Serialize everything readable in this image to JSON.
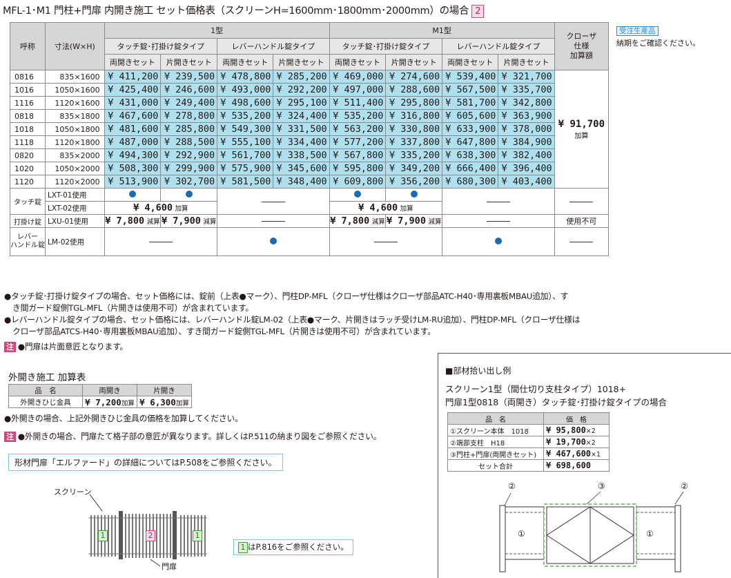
{
  "title": {
    "text": "MFL-1･M1 門柱+門扉 内開き施工 セット価格表（スクリーンH=1600mm･1800mm･2000mm）の場合",
    "badge": "2"
  },
  "juchu": {
    "label": "受注生産品",
    "note": "納期をご確認ください。"
  },
  "table": {
    "h_name": "呼称",
    "h_size": "寸法(W×H)",
    "h_type1": "1型",
    "h_typeM1": "M1型",
    "h_touch": "タッチ錠･打掛け錠タイプ",
    "h_lever": "レバーハンドル錠タイプ",
    "h_both": "両開きセット",
    "h_single": "片開きセット",
    "h_closer": "クローザ",
    "h_closer2": "仕様",
    "h_closer3": "加算額",
    "closer_price": "¥ 91,700",
    "closer_add": "加算",
    "rows": [
      {
        "code": "0816",
        "size": "835×1600",
        "p": [
          "¥ 411,200",
          "¥ 239,500",
          "¥ 478,800",
          "¥ 285,200",
          "¥ 469,000",
          "¥ 274,600",
          "¥ 539,400",
          "¥ 321,700"
        ]
      },
      {
        "code": "1016",
        "size": "1050×1600",
        "p": [
          "¥ 425,400",
          "¥ 246,600",
          "¥ 493,000",
          "¥ 292,200",
          "¥ 497,000",
          "¥ 288,600",
          "¥ 567,500",
          "¥ 335,700"
        ]
      },
      {
        "code": "1116",
        "size": "1120×1600",
        "p": [
          "¥ 431,000",
          "¥ 249,400",
          "¥ 498,600",
          "¥ 295,100",
          "¥ 511,400",
          "¥ 295,800",
          "¥ 581,700",
          "¥ 342,800"
        ]
      },
      {
        "code": "0818",
        "size": "835×1800",
        "p": [
          "¥ 467,600",
          "¥ 278,800",
          "¥ 535,200",
          "¥ 324,400",
          "¥ 535,200",
          "¥ 316,800",
          "¥ 605,600",
          "¥ 363,900"
        ]
      },
      {
        "code": "1018",
        "size": "1050×1800",
        "p": [
          "¥ 481,600",
          "¥ 285,800",
          "¥ 549,300",
          "¥ 331,500",
          "¥ 563,200",
          "¥ 330,800",
          "¥ 633,900",
          "¥ 378,000"
        ]
      },
      {
        "code": "1118",
        "size": "1120×1800",
        "p": [
          "¥ 487,000",
          "¥ 288,500",
          "¥ 555,100",
          "¥ 334,400",
          "¥ 577,200",
          "¥ 337,800",
          "¥ 647,800",
          "¥ 384,900"
        ]
      },
      {
        "code": "0820",
        "size": "835×2000",
        "p": [
          "¥ 494,300",
          "¥ 292,900",
          "¥ 561,700",
          "¥ 338,500",
          "¥ 567,800",
          "¥ 335,200",
          "¥ 638,300",
          "¥ 382,400"
        ]
      },
      {
        "code": "1020",
        "size": "1050×2000",
        "p": [
          "¥ 508,300",
          "¥ 299,900",
          "¥ 575,900",
          "¥ 345,600",
          "¥ 595,800",
          "¥ 349,200",
          "¥ 666,400",
          "¥ 396,400"
        ]
      },
      {
        "code": "1120",
        "size": "1120×2000",
        "p": [
          "¥ 513,900",
          "¥ 302,700",
          "¥ 581,500",
          "¥ 348,400",
          "¥ 609,800",
          "¥ 356,200",
          "¥ 680,300",
          "¥ 403,400"
        ]
      }
    ],
    "touch_label": "タッチ錠",
    "lxt01": "LXT-01使用",
    "lxt02": "LXT-02使用",
    "lxt02_price": "¥ 4,600",
    "add": "加算",
    "uchikake_label": "打掛け錠",
    "lxu01": "LXU-01使用",
    "lxu_both": "¥ 7,800",
    "lxu_single": "¥ 7,900",
    "minus": "減算",
    "not_usable": "使用不可",
    "lever_label1": "レバー",
    "lever_label2": "ハンドル錠",
    "lm02": "LM-02使用"
  },
  "notes": {
    "n1a": "●タッチ錠･打掛け錠タイプの場合、セット価格には、錠前（上表●マーク）、門柱DP-MFL（クローザ仕様はクローザ部品ATC-H40･専用裏板MBAU追加）、す",
    "n1b": "き間ガード錠側TGL-MFL（片開きは使用不可）が含まれています。",
    "n2a": "●レバーハンドル錠タイプの場合、セット価格には、レバーハンドル錠LM-02（上表●マーク、片開きはラッチ受けLM-RU追加）、門柱DP-MFL（クローザ仕様は",
    "n2b": "クローザ部品ATCS-H40･専用裏板MBAU追加）、すき間ガード錠側TGL-MFL（片開きは使用不可）が含まれています。",
    "chu": "注",
    "n3": "●門扉は片面意匠となります。"
  },
  "outside": {
    "title": "外開き施工 加算表",
    "h_name": "品　名",
    "h_both": "両開き",
    "h_single": "片開き",
    "item": "外開きひじ金具",
    "both": "¥ 7,200",
    "single": "¥ 6,300",
    "add": "加算",
    "note1": "●外開きの場合、上記外開きひじ金具の価格を加算してください。",
    "note2": "●外開きの場合、門扉たて格子部の意匠が異なります。詳しくはP.511の納まり図をご参照ください。"
  },
  "ref": {
    "text": "形材門扉「エルファード」の詳細についてはP.508をご参照ください。"
  },
  "diagram": {
    "screen": "スクリーン",
    "gate": "門扉",
    "one": "1",
    "two": "2",
    "ref_note": "はP.816をご参照ください。"
  },
  "parts": {
    "title": "■部材拾い出し例",
    "sub1": "スクリーン1型（間仕切り支柱タイプ）1018+",
    "sub2": "門扉1型0818（両開き）タッチ錠･打掛け錠タイプの場合",
    "h_name": "品　名",
    "h_price": "価　格",
    "items": [
      {
        "name": "①スクリーン本体　1018",
        "price": "¥ 95,800",
        "qty": "×2"
      },
      {
        "name": "②端部支柱　H18",
        "price": "¥ 19,700",
        "qty": "×2"
      },
      {
        "name": "③門柱+門扉(両開きセット)",
        "price": "¥ 467,600",
        "qty": "×1"
      }
    ],
    "total_label": "セット合計",
    "total": "¥ 698,600",
    "c1": "①",
    "c2": "②",
    "c3": "③"
  }
}
